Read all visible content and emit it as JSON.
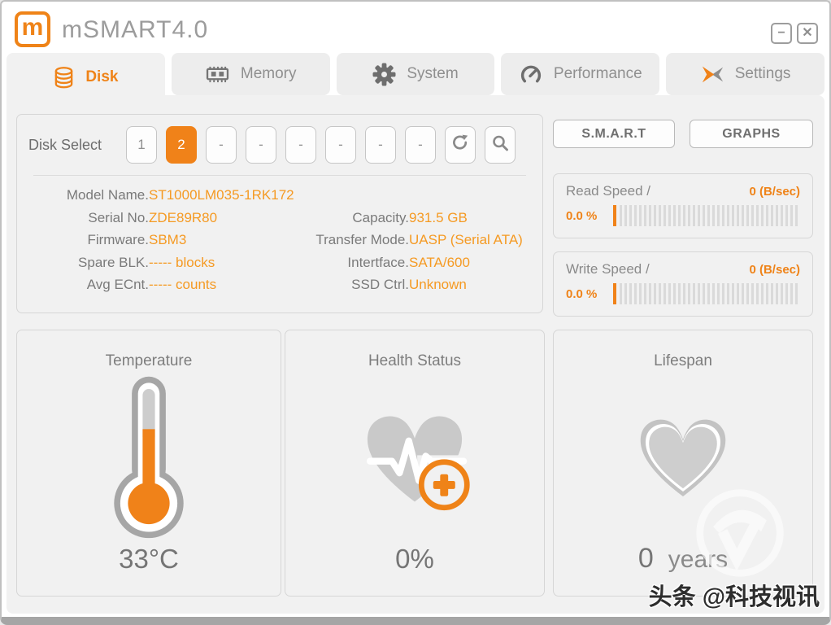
{
  "window": {
    "title": "mSMART4.0",
    "logo_letter": "m",
    "controls": {
      "minimize": "−",
      "close": "✕"
    }
  },
  "tabs": [
    {
      "label": "Disk",
      "icon": "disk-icon",
      "active": true
    },
    {
      "label": "Memory",
      "icon": "memory-icon",
      "active": false
    },
    {
      "label": "System",
      "icon": "gear-icon",
      "active": false
    },
    {
      "label": "Performance",
      "icon": "gauge-icon",
      "active": false
    },
    {
      "label": "Settings",
      "icon": "settings-icon",
      "active": false
    }
  ],
  "disk_select": {
    "label": "Disk Select",
    "buttons": [
      {
        "label": "1",
        "selected": false
      },
      {
        "label": "2",
        "selected": true
      },
      {
        "label": "-",
        "selected": false
      },
      {
        "label": "-",
        "selected": false
      },
      {
        "label": "-",
        "selected": false
      },
      {
        "label": "-",
        "selected": false
      },
      {
        "label": "-",
        "selected": false
      },
      {
        "label": "-",
        "selected": false
      }
    ]
  },
  "disk_info": {
    "rows": [
      {
        "left_label": "Model Name.",
        "left_value": "ST1000LM035-1RK172",
        "right_label": "",
        "right_value": ""
      },
      {
        "left_label": "Serial No.",
        "left_value": "ZDE89R80",
        "right_label": "Capacity.",
        "right_value": "931.5 GB"
      },
      {
        "left_label": "Firmware.",
        "left_value": "SBM3",
        "right_label": "Transfer Mode.",
        "right_value": "UASP (Serial ATA)"
      },
      {
        "left_label": "Spare BLK.",
        "left_value": "----- blocks",
        "right_label": "Intertface.",
        "right_value": "SATA/600"
      },
      {
        "left_label": "Avg ECnt.",
        "left_value": "----- counts",
        "right_label": "SSD Ctrl.",
        "right_value": "Unknown"
      }
    ]
  },
  "actions": {
    "smart_label": "S.M.A.R.T",
    "graphs_label": "GRAPHS"
  },
  "speed_panels": [
    {
      "title": "Read Speed /",
      "rate": "0 (B/sec)",
      "percent": "0.0 %"
    },
    {
      "title": "Write Speed /",
      "rate": "0 (B/sec)",
      "percent": "0.0 %"
    }
  ],
  "status_panels": {
    "temperature": {
      "title": "Temperature",
      "value": "33°C"
    },
    "health": {
      "title": "Health Status",
      "value": "0%"
    },
    "lifespan": {
      "title": "Lifespan",
      "value": "0",
      "unit": "years"
    }
  },
  "watermark": {
    "text": "头条 @科技视讯"
  },
  "colors": {
    "accent_orange": "#ef8318",
    "value_orange": "#f59a23"
  }
}
